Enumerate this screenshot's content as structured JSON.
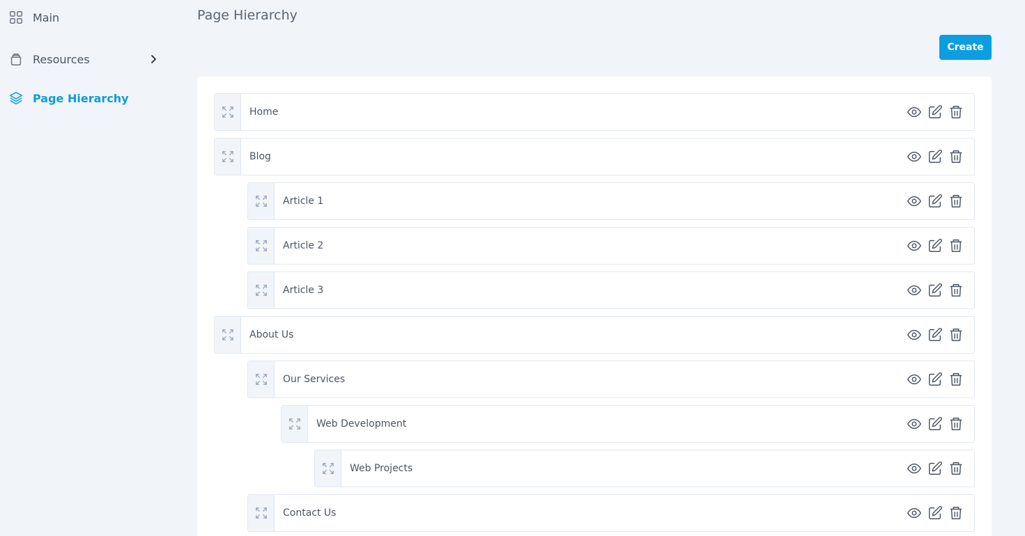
{
  "sidebar": {
    "items": [
      {
        "label": "Main",
        "icon": "grid-icon"
      },
      {
        "label": "Resources",
        "icon": "box-icon",
        "has_submenu": true
      },
      {
        "label": "Page Hierarchy",
        "icon": "layers-icon",
        "active": true
      }
    ]
  },
  "header": {
    "title": "Page Hierarchy",
    "create_label": "Create"
  },
  "colors": {
    "accent": "#0b9ee0",
    "active_nav": "#0e9dd4",
    "background": "#f1f5f9"
  },
  "pages": [
    {
      "label": "Home",
      "depth": 0
    },
    {
      "label": "Blog",
      "depth": 0
    },
    {
      "label": "Article 1",
      "depth": 1
    },
    {
      "label": "Article 2",
      "depth": 1
    },
    {
      "label": "Article 3",
      "depth": 1
    },
    {
      "label": "About Us",
      "depth": 0
    },
    {
      "label": "Our Services",
      "depth": 1
    },
    {
      "label": "Web Development",
      "depth": 2
    },
    {
      "label": "Web Projects",
      "depth": 3
    },
    {
      "label": "Contact Us",
      "depth": 1
    }
  ],
  "row_actions": [
    "eye-icon",
    "edit-icon",
    "trash-icon"
  ]
}
